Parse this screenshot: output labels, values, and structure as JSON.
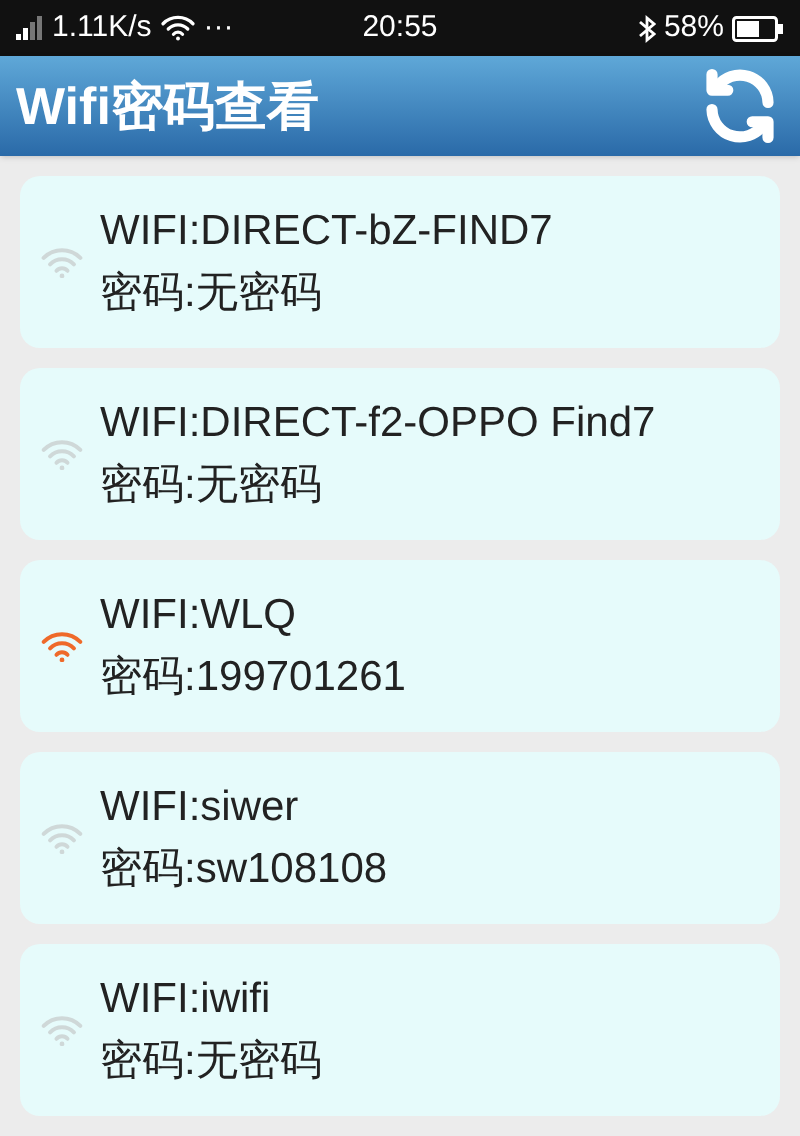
{
  "status_bar": {
    "speed": "1.11K/s",
    "more": "···",
    "time": "20:55",
    "battery": "58%"
  },
  "header": {
    "title": "Wifi密码查看"
  },
  "networks": [
    {
      "ssid": "WIFI:DIRECT-bZ-FIND7",
      "password": "密码:无密码",
      "connected": false
    },
    {
      "ssid": "WIFI:DIRECT-f2-OPPO Find7",
      "password": "密码:无密码",
      "connected": false
    },
    {
      "ssid": "WIFI:WLQ",
      "password": "密码:199701261",
      "connected": true
    },
    {
      "ssid": "WIFI:siwer",
      "password": "密码:sw108108",
      "connected": false
    },
    {
      "ssid": "WIFI:iwifi",
      "password": "密码:无密码",
      "connected": false
    }
  ]
}
